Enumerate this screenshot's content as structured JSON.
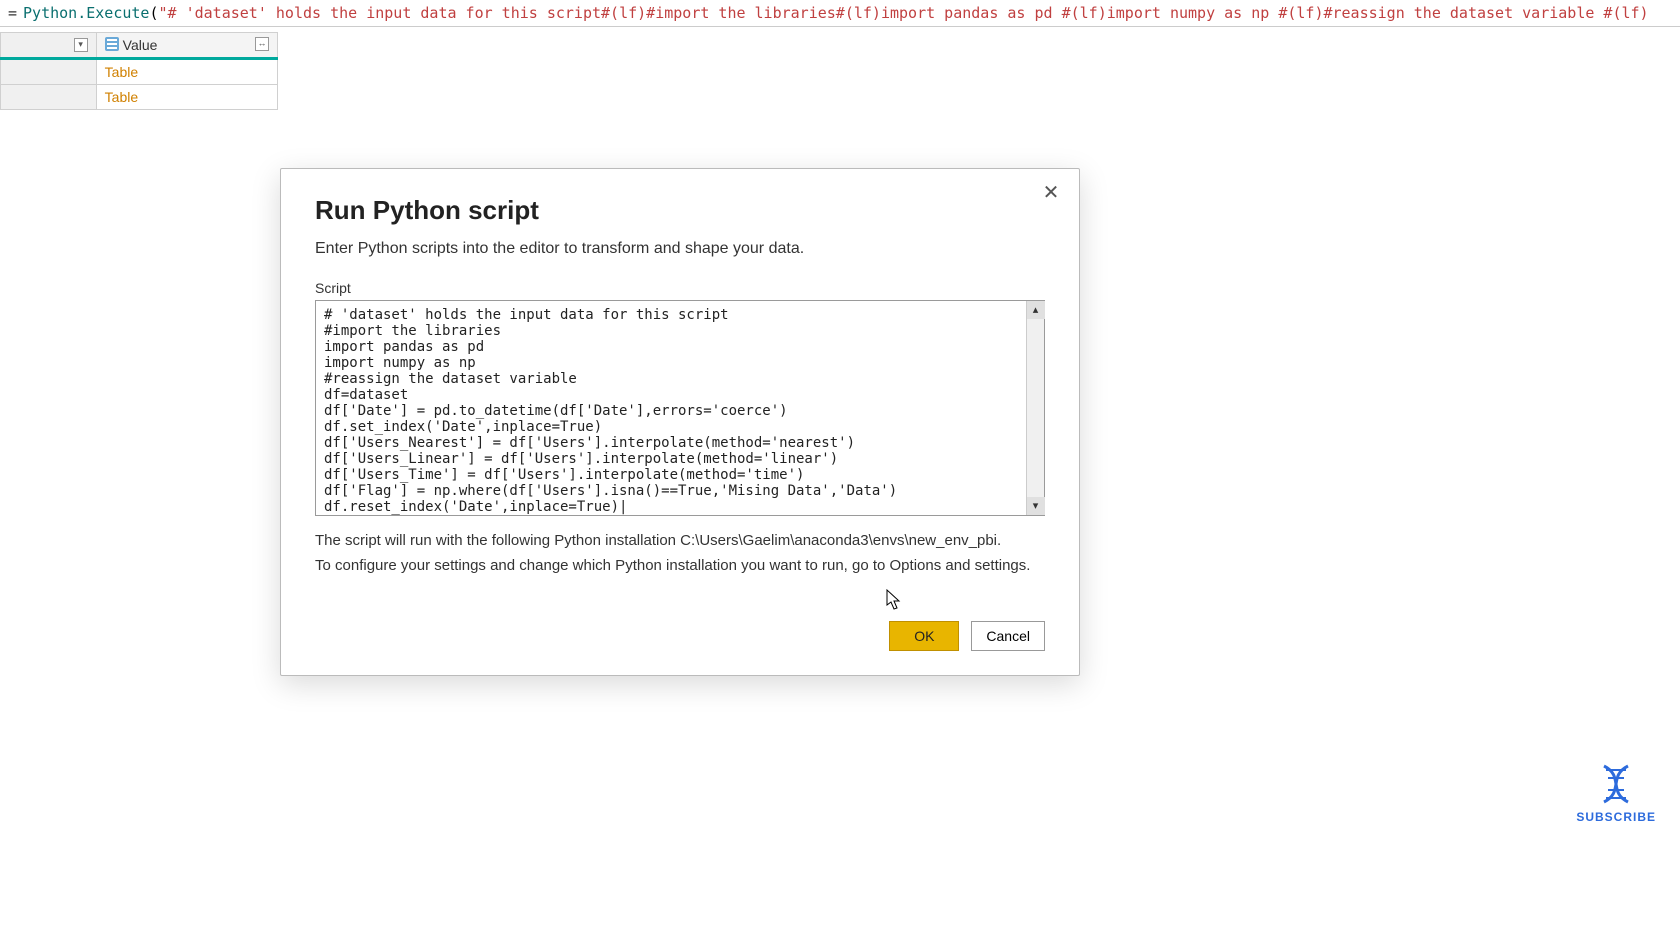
{
  "formula_bar": {
    "equals": "=",
    "function": "Python.Execute",
    "open": "(",
    "arg": "\"# 'dataset' holds the input data for this script#(lf)#import the libraries#(lf)import pandas as pd #(lf)import numpy as np #(lf)#reassign the dataset variable #(lf)",
    "close": ""
  },
  "columns": {
    "index_header": "",
    "value_header": "Value",
    "rows": [
      {
        "link": "Table"
      },
      {
        "link": "Table"
      }
    ]
  },
  "dialog": {
    "title": "Run Python script",
    "subtitle": "Enter Python scripts into the editor to transform and shape your data.",
    "script_label": "Script",
    "script_text": "# 'dataset' holds the input data for this script\n#import the libraries\nimport pandas as pd\nimport numpy as np\n#reassign the dataset variable\ndf=dataset\ndf['Date'] = pd.to_datetime(df['Date'],errors='coerce')\ndf.set_index('Date',inplace=True)\ndf['Users_Nearest'] = df['Users'].interpolate(method='nearest')\ndf['Users_Linear'] = df['Users'].interpolate(method='linear')\ndf['Users_Time'] = df['Users'].interpolate(method='time')\ndf['Flag'] = np.where(df['Users'].isna()==True,'Mising Data','Data')\ndf.reset_index('Date',inplace=True)|",
    "info_line1": "The script will run with the following Python installation C:\\Users\\Gaelim\\anaconda3\\envs\\new_env_pbi.",
    "info_line2": "To configure your settings and change which Python installation you want to run, go to Options and settings.",
    "ok_label": "OK",
    "cancel_label": "Cancel"
  },
  "subscribe": {
    "label": "SUBSCRIBE"
  }
}
